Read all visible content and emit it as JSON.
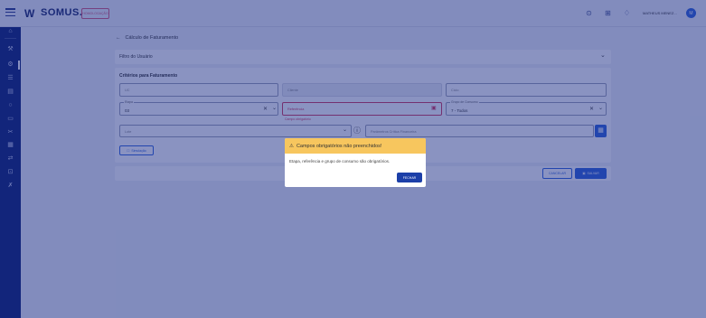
{
  "header": {
    "logo_mark": "W",
    "logo_text": "SOMUS.",
    "env_badge": "HOMOLOGAÇÃO",
    "user_name": "MATHEUS MENEZ...",
    "avatar_initial": "M",
    "icons": [
      "help-circle-icon",
      "grid-icon",
      "bell-icon"
    ]
  },
  "sidebar": {
    "icons": [
      "home-icon",
      "tools-icon",
      "settings-icon",
      "list-icon",
      "calendar-icon",
      "circle-icon",
      "card-icon",
      "scissors-icon",
      "keyboard-icon",
      "swap-icon",
      "chart-icon",
      "wrench-icon"
    ]
  },
  "page": {
    "back_arrow": "←",
    "title": "Cálculo de Faturamento"
  },
  "filter_panel": {
    "title": "Filtro do Usuário",
    "chevron": "⌄"
  },
  "criteria": {
    "title": "Critérios para Faturamento",
    "uc_placeholder": "UC",
    "cliente_placeholder": "Cliente",
    "ciclo_placeholder": "Ciclo",
    "etapa_label": "Etapa",
    "etapa_value": "03",
    "referencia_placeholder": "Referência",
    "referencia_helper": "Campo obrigatório",
    "grupo_label": "Grupo de Consumo",
    "grupo_value": "7 - Todos",
    "lote_placeholder": "Lote",
    "parametros_placeholder": "Parâmetros Crítica Financeira",
    "simulacao_label": "Simulação",
    "clear_symbol": "✕",
    "dropdown_symbol": "⌄",
    "info_symbol": "ⓘ"
  },
  "actions": {
    "cancel_label": "CANCELAR",
    "save_label": "SALVAR"
  },
  "modal": {
    "title": "Campos obrigatórios não preenchidos!",
    "message": "Etapa, referência e grupo de consumo são obrigatórios.",
    "close_label": "FECHAR",
    "warning_symbol": "⚠"
  },
  "colors": {
    "primary": "#2e63d8",
    "sidebar": "#0f2372",
    "warning": "#f7c65e",
    "error": "#d33b5d",
    "overlay": "rgba(21, 40, 132, 0.5)"
  }
}
